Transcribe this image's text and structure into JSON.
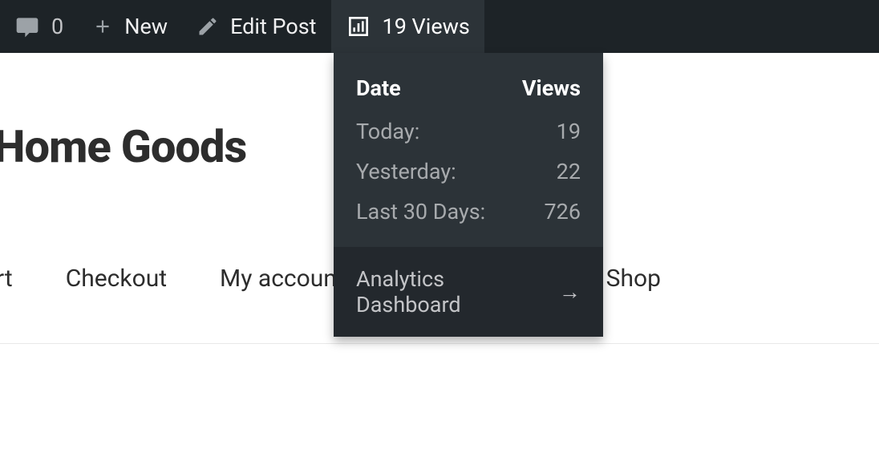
{
  "admin_bar": {
    "comments_count": "0",
    "new_label": "New",
    "edit_label": "Edit Post",
    "views_label": "19 Views"
  },
  "dropdown": {
    "header_date": "Date",
    "header_views": "Views",
    "rows": [
      {
        "label": "Today:",
        "value": "19"
      },
      {
        "label": "Yesterday:",
        "value": "22"
      },
      {
        "label": "Last 30 Days:",
        "value": "726"
      }
    ],
    "footer_label": "Analytics Dashboard",
    "footer_arrow": "→"
  },
  "site": {
    "title": "Home Goods"
  },
  "nav": {
    "items": [
      "rt",
      "Checkout",
      "My account",
      "Shop"
    ]
  }
}
